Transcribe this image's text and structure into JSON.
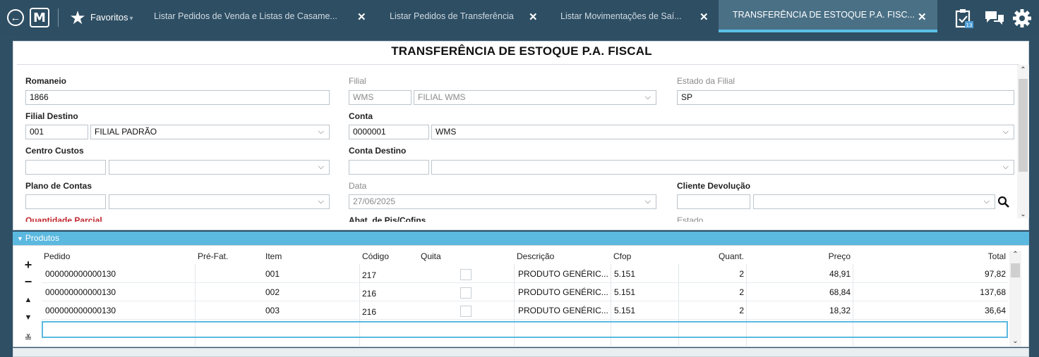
{
  "topbar": {
    "favorites_label": "Favoritos",
    "favorites_caret": "▾",
    "tabs": [
      {
        "label": "Listar Pedidos de Venda e Listas de Casame...",
        "close": "✕"
      },
      {
        "label": "Listar Pedidos de Transferência",
        "close": "✕"
      },
      {
        "label": "Listar Movimentações de Saí...",
        "close": "✕"
      },
      {
        "label": "TRANSFERÊNCIA DE ESTOQUE P.A. FISC...",
        "close": "✕"
      }
    ],
    "notification_badge": "13"
  },
  "form": {
    "title": "TRANSFERÊNCIA DE ESTOQUE P.A. FISCAL",
    "romaneio": {
      "label": "Romaneio",
      "value": "1866"
    },
    "filial": {
      "label": "Filial",
      "code": "WMS",
      "name": "FILIAL WMS"
    },
    "estado_filial": {
      "label": "Estado da Filial",
      "value": "SP"
    },
    "filial_destino": {
      "label": "Filial Destino",
      "code": "001",
      "name": "FILIAL PADRÃO"
    },
    "conta": {
      "label": "Conta",
      "code": "0000001",
      "name": "WMS"
    },
    "centro_custos": {
      "label": "Centro Custos",
      "code": "",
      "name": ""
    },
    "conta_destino": {
      "label": "Conta Destino",
      "code": "",
      "name": ""
    },
    "plano_contas": {
      "label": "Plano de Contas",
      "code": "",
      "name": ""
    },
    "data": {
      "label": "Data",
      "value": "27/06/2025"
    },
    "cliente_devolucao": {
      "label": "Cliente Devolução",
      "code": "",
      "name": ""
    },
    "quantidade_parcial": {
      "label": "Quantidade Parcial"
    },
    "abat_pis_cofins": {
      "label": "Abat. de Pis/Cofins"
    },
    "estado": {
      "label": "Estado"
    }
  },
  "produtos": {
    "section_label": "Produtos",
    "buttons": {
      "add": "+",
      "remove": "−",
      "up": "▲",
      "down": "▼",
      "expand": "≚"
    },
    "columns": [
      "Pedido",
      "Pré-Fat.",
      "Item",
      "Código",
      "Quita",
      "Descrição",
      "Cfop",
      "Quant.",
      "Preço",
      "Total"
    ],
    "rows": [
      {
        "pedido": "000000000000130",
        "prefat": "",
        "item": "001",
        "codigo": "217",
        "quita": false,
        "descricao": "PRODUTO GENÉRIC...",
        "cfop": "5.151",
        "quant": "2",
        "preco": "48,91",
        "total": "97,82"
      },
      {
        "pedido": "000000000000130",
        "prefat": "",
        "item": "002",
        "codigo": "216",
        "quita": false,
        "descricao": "PRODUTO GENÉRIC...",
        "cfop": "5.151",
        "quant": "2",
        "preco": "68,84",
        "total": "137,68"
      },
      {
        "pedido": "000000000000130",
        "prefat": "",
        "item": "003",
        "codigo": "216",
        "quita": false,
        "descricao": "PRODUTO GENÉRIC...",
        "cfop": "5.151",
        "quant": "2",
        "preco": "18,32",
        "total": "36,64"
      }
    ]
  }
}
